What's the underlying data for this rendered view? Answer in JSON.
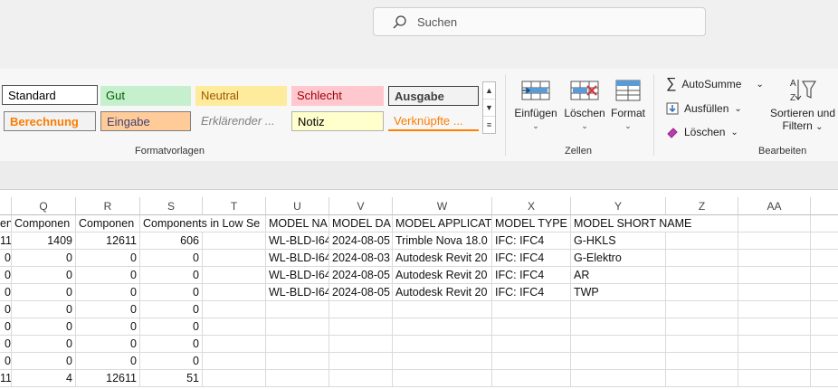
{
  "search": {
    "placeholder": "Suchen"
  },
  "styles_gallery": {
    "items": [
      {
        "label": "Standard"
      },
      {
        "label": "Gut"
      },
      {
        "label": "Neutral"
      },
      {
        "label": "Schlecht"
      },
      {
        "label": "Ausgabe"
      },
      {
        "label": "Berechnung"
      },
      {
        "label": "Eingabe"
      },
      {
        "label": "Erklärender ..."
      },
      {
        "label": "Notiz"
      },
      {
        "label": "Verknüpfte ..."
      }
    ],
    "group_label": "Formatvorlagen"
  },
  "cells_group": {
    "insert_label": "Einfügen",
    "delete_label": "Löschen",
    "format_label": "Format",
    "group_label": "Zellen"
  },
  "edit_group": {
    "autosum_label": "AutoSumme",
    "fill_label": "Ausfüllen",
    "clear_label": "Löschen",
    "sort_label_1": "Sortieren und",
    "sort_label_2": "Filtern",
    "group_label": "Bearbeiten"
  },
  "sheet": {
    "columns": [
      "Q",
      "R",
      "S",
      "T",
      "U",
      "V",
      "W",
      "X",
      "Y",
      "Z",
      "AA"
    ],
    "header_row": {
      "p": "en",
      "q": "Componen",
      "r": "Componen",
      "s": "Components in Low Se",
      "u": "MODEL NA",
      "v": "MODEL DA",
      "w": "MODEL APPLICAT",
      "x": "MODEL TYPE",
      "y": "MODEL SHORT NAME"
    },
    "rows": [
      {
        "p": "11",
        "q": "1409",
        "r": "12611",
        "s": "606",
        "u": "WL-BLD-I64",
        "v": "2024-08-05",
        "w": "Trimble Nova 18.0",
        "x": "IFC: IFC4",
        "y": "G-HKLS"
      },
      {
        "p": "0",
        "q": "0",
        "r": "0",
        "s": "0",
        "u": "WL-BLD-I64",
        "v": "2024-08-03",
        "w": "Autodesk Revit 20",
        "x": "IFC: IFC4",
        "y": "G-Elektro"
      },
      {
        "p": "0",
        "q": "0",
        "r": "0",
        "s": "0",
        "u": "WL-BLD-I64",
        "v": "2024-08-05",
        "w": "Autodesk Revit 20",
        "x": "IFC: IFC4",
        "y": "AR"
      },
      {
        "p": "0",
        "q": "0",
        "r": "0",
        "s": "0",
        "u": "WL-BLD-I64",
        "v": "2024-08-05",
        "w": "Autodesk Revit 20",
        "x": "IFC: IFC4",
        "y": "TWP"
      },
      {
        "p": "0",
        "q": "0",
        "r": "0",
        "s": "0",
        "u": "",
        "v": "",
        "w": "",
        "x": "",
        "y": ""
      },
      {
        "p": "0",
        "q": "0",
        "r": "0",
        "s": "0",
        "u": "",
        "v": "",
        "w": "",
        "x": "",
        "y": ""
      },
      {
        "p": "0",
        "q": "0",
        "r": "0",
        "s": "0",
        "u": "",
        "v": "",
        "w": "",
        "x": "",
        "y": ""
      },
      {
        "p": "0",
        "q": "0",
        "r": "0",
        "s": "0",
        "u": "",
        "v": "",
        "w": "",
        "x": "",
        "y": ""
      },
      {
        "p": "11",
        "q": "4",
        "r": "12611",
        "s": "51",
        "u": "",
        "v": "",
        "w": "",
        "x": "",
        "y": ""
      }
    ]
  }
}
